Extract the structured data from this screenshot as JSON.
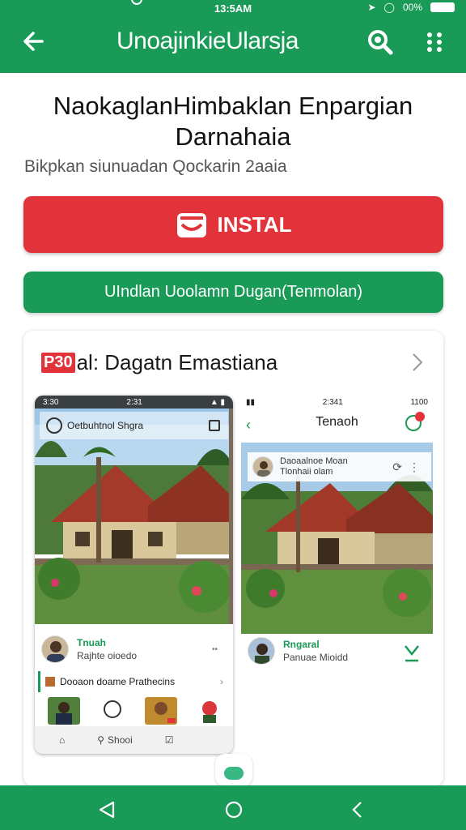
{
  "status_bar": {
    "time": "13:5AM",
    "battery_text": "00%"
  },
  "app_bar": {
    "title": "UnoajinkieUlarsja",
    "back_icon": "arrow-left-icon",
    "search_icon": "search-icon",
    "more_icon": "more-vert-icon"
  },
  "app": {
    "title_line1": "NaokaglanHimbaklan Enpargian",
    "title_line2": "Darnahaia",
    "subtitle": "Bikpkan siunuadan Qockarin 2aaia"
  },
  "actions": {
    "install_label": "INSTAL",
    "secondary_label": "UIndlan Uoolamn Dugan(Tenmolan)"
  },
  "preview": {
    "badge": "P30",
    "title": "al:  Dagatn Emastiana",
    "left_screen": {
      "status_time": "2:31",
      "status_left": "3:30",
      "bar_title": "Oetbuhtnol Shgra",
      "user_name": "Tnuah",
      "user_sub": "Rajhte oioedo",
      "user_meta": "••",
      "section_title": "Dooaon doame Prathecins",
      "nav_search": "Shooi"
    },
    "right_screen": {
      "status_time": "2:341",
      "status_right": "1100",
      "header_title": "Tenaoh",
      "post_title": "Daoaalnoe Moan",
      "post_sub": "Tlonhaii olam",
      "user_name": "Rngaral",
      "user_sub": "Panuae Mioidd"
    }
  },
  "colors": {
    "primary": "#1a9a57",
    "accent": "#e3333a"
  }
}
